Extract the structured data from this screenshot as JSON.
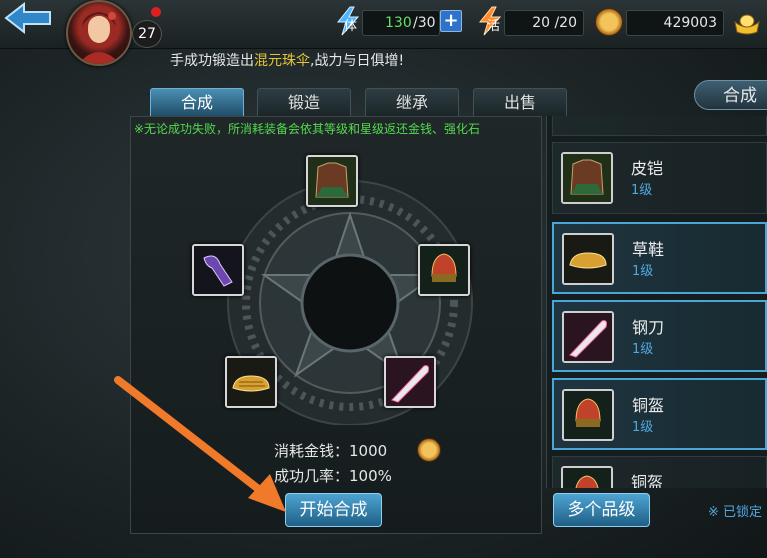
{
  "player": {
    "level": "27"
  },
  "resources": {
    "stamina_label": "体",
    "stamina_current": "130",
    "stamina_max": "/30",
    "vigor_label": "活",
    "vigor_value": "20 /20",
    "coins": "429003"
  },
  "marquee": {
    "prefix": "手成功锻造出",
    "item": "混元珠伞",
    "suffix": ",战力与日俱增!"
  },
  "tabs": [
    {
      "label": "合成",
      "active": true
    },
    {
      "label": "锻造",
      "active": false
    },
    {
      "label": "继承",
      "active": false
    },
    {
      "label": "出售",
      "active": false
    }
  ],
  "right_tab": {
    "label": "合成"
  },
  "synth": {
    "notice": "※无论成功失败，所消耗装备会依其等级和星级返还金钱、强化石",
    "cost_label": "消耗金钱：1000",
    "rate_label": "成功几率：100%",
    "start_button": "开始合成"
  },
  "item_list": [
    {
      "name": "皮铠",
      "level": "1级",
      "selected": false,
      "icon": "leather-armor-icon"
    },
    {
      "name": "草鞋",
      "level": "1级",
      "selected": true,
      "icon": "straw-sandal-icon"
    },
    {
      "name": "钢刀",
      "level": "1级",
      "selected": true,
      "icon": "steel-blade-icon"
    },
    {
      "name": "铜盔",
      "level": "1级",
      "selected": true,
      "icon": "bronze-helmet-icon"
    },
    {
      "name": "铜盔",
      "level": "",
      "selected": false,
      "icon": "bronze-helmet-icon"
    }
  ],
  "footer": {
    "multi_grade_button": "多个品级",
    "locked_label": "※ 已锁定"
  },
  "colors": {
    "accent": "#4aa6d6",
    "notice_green": "#55d94f",
    "highlight_gold": "#e6c43a",
    "arrow_orange": "#f07a2a"
  }
}
